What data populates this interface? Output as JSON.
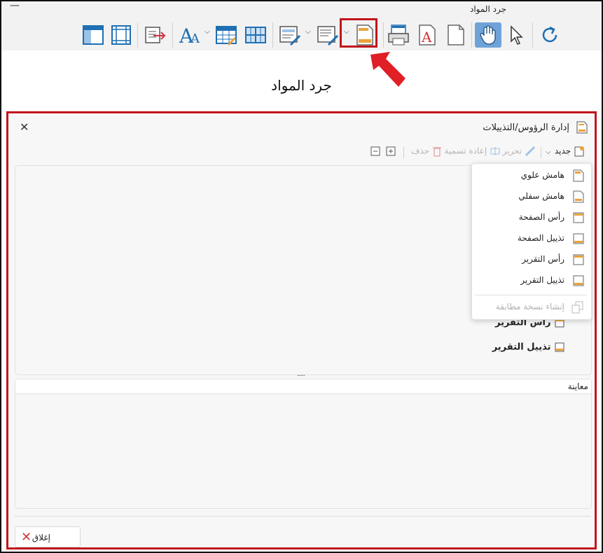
{
  "window": {
    "title": "جرد المواد",
    "minimize": "—"
  },
  "page_heading": "جرد المواد",
  "dialog": {
    "title": "إدارة الرؤوس/التذييلات",
    "close_glyph": "✕",
    "toolbar": {
      "new": "جديد",
      "edit": "تحرير",
      "rename": "إعادة تسمية",
      "delete": "حذف"
    },
    "menu": {
      "items": [
        {
          "label": "هامش علوي",
          "icon": "top-margin-icon",
          "enabled": true
        },
        {
          "label": "هامش سفلي",
          "icon": "bottom-margin-icon",
          "enabled": true
        },
        {
          "label": "رأس الصفحة",
          "icon": "page-header-icon",
          "enabled": true
        },
        {
          "label": "تذييل الصفحة",
          "icon": "page-footer-icon",
          "enabled": true
        },
        {
          "label": "رأس التقرير",
          "icon": "report-header-icon",
          "enabled": true
        },
        {
          "label": "تذييل التقرير",
          "icon": "report-footer-icon",
          "enabled": true
        },
        {
          "label": "إنشاء نسخة مطابقة",
          "icon": "duplicate-icon",
          "enabled": false
        }
      ]
    },
    "list_items": [
      {
        "label": "رأس التقرير",
        "icon": "report-header-icon"
      },
      {
        "label": "تذييل التقرير",
        "icon": "report-footer-icon"
      }
    ],
    "splitter": "·····",
    "preview_label": "معاينة",
    "close_button": "إغلاق"
  },
  "colors": {
    "highlight_red": "#c0161c",
    "accent_blue": "#1f6fb4",
    "active_tool_bg": "#6fa3d8",
    "header_footer_orange": "#e9a23b"
  }
}
